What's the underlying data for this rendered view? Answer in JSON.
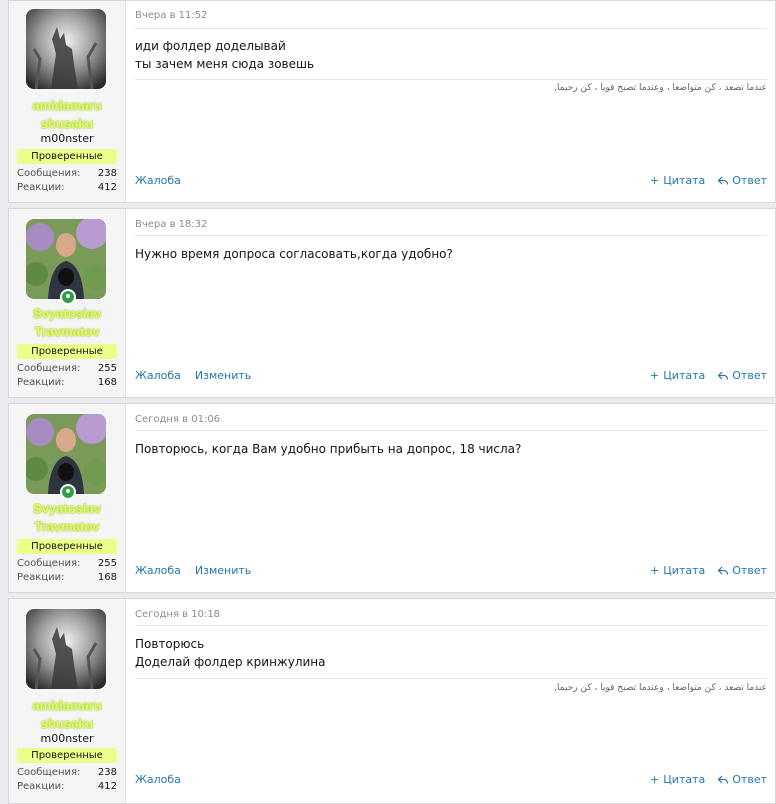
{
  "posts": [
    {
      "date": "Вчера в 11:52",
      "user": {
        "name_line1": "amidamaru",
        "name_line2": "shusaku",
        "title": "m00nster",
        "banner": "Проверенные",
        "online": false,
        "avatar": "ghost-hand-photo"
      },
      "stats": {
        "messages_label": "Сообщения:",
        "messages": "238",
        "reactions_label": "Реакции:",
        "reactions": "412"
      },
      "lines": [
        "иди фолдер доделывай",
        "ты зачем меня сюда зовешь"
      ],
      "signature": ",عندما تصعد ، كن متواضعا ، وعندما تصبح قويا ، كن رحيما",
      "actions": {
        "report": "Жалоба",
        "edit": "",
        "quote": "Цитата",
        "reply": "Ответ"
      }
    },
    {
      "date": "Вчера в 18:32",
      "user": {
        "name_line1": "Svyatoslav",
        "name_line2": "Travmatov",
        "title": "",
        "banner": "Проверенные",
        "online": true,
        "avatar": "man-with-dog-photo"
      },
      "stats": {
        "messages_label": "Сообщения:",
        "messages": "255",
        "reactions_label": "Реакции:",
        "reactions": "168"
      },
      "lines": [
        "Нужно время допроса согласовать,когда удобно?"
      ],
      "signature": "",
      "actions": {
        "report": "Жалоба",
        "edit": "Изменить",
        "quote": "Цитата",
        "reply": "Ответ"
      }
    },
    {
      "date": "Сегодня в 01:06",
      "user": {
        "name_line1": "Svyatoslav",
        "name_line2": "Travmatov",
        "title": "",
        "banner": "Проверенные",
        "online": true,
        "avatar": "man-with-dog-photo"
      },
      "stats": {
        "messages_label": "Сообщения:",
        "messages": "255",
        "reactions_label": "Реакции:",
        "reactions": "168"
      },
      "lines": [
        "Повторюсь, когда Вам удобно прибыть на допрос, 18 числа?"
      ],
      "signature": "",
      "actions": {
        "report": "Жалоба",
        "edit": "Изменить",
        "quote": "Цитата",
        "reply": "Ответ"
      }
    },
    {
      "date": "Сегодня в 10:18",
      "user": {
        "name_line1": "amidamaru",
        "name_line2": "shusaku",
        "title": "m00nster",
        "banner": "Проверенные",
        "online": false,
        "avatar": "ghost-hand-photo"
      },
      "stats": {
        "messages_label": "Сообщения:",
        "messages": "238",
        "reactions_label": "Реакции:",
        "reactions": "412"
      },
      "lines": [
        "Повторюсь",
        "Доделай фолдер кринжулина"
      ],
      "signature": ",عندما تصعد ، كن متواضعا ، وعندما تصبح قويا ، كن رحيما",
      "actions": {
        "report": "Жалоба",
        "edit": "",
        "quote": "Цитата",
        "reply": "Ответ"
      }
    }
  ],
  "colors": {
    "link": "#2577b1",
    "username": "#d9ff5a",
    "banner_bg": "#ecff8a",
    "online": "#2f9e44"
  }
}
